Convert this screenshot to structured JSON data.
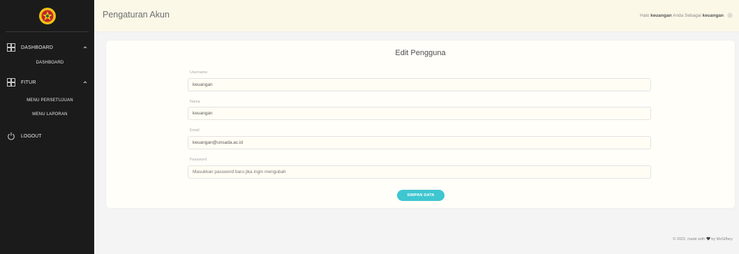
{
  "sidebar": {
    "groups": [
      {
        "label": "DASHBOARD",
        "icon": "grid-icon",
        "items": [
          {
            "label": "DASHBOARD"
          }
        ]
      },
      {
        "label": "FITUR",
        "icon": "grid-icon",
        "items": [
          {
            "label": "MENU PERSETUJUAN"
          },
          {
            "label": "MENU LAPORAN"
          }
        ]
      }
    ],
    "logout": {
      "label": "LOGOUT",
      "icon": "power-icon"
    }
  },
  "header": {
    "title": "Pengaturan Akun",
    "greeting_prefix": "Halo",
    "user": "keuangan",
    "greeting_middle": "Anda Sebagai",
    "role": "keuangan",
    "icon": "gear-icon"
  },
  "form": {
    "title": "Edit Pengguna",
    "fields": [
      {
        "label": "Username",
        "value": "keuangan",
        "placeholder": ""
      },
      {
        "label": "Nama",
        "value": "keuangan",
        "placeholder": ""
      },
      {
        "label": "Email",
        "value": "keuangan@unsada.ac.id",
        "placeholder": ""
      },
      {
        "label": "Password",
        "value": "",
        "placeholder": "Masukkan password baru jika ingin mengubah"
      }
    ],
    "submit_label": "SIMPAN DATA"
  },
  "footer": {
    "prefix": "© 2022, made with",
    "suffix": "by MzGiffary"
  },
  "colors": {
    "sidebar_bg": "#1b1b1b",
    "header_bg": "#fbf8e8",
    "accent": "#3ec6d1"
  }
}
